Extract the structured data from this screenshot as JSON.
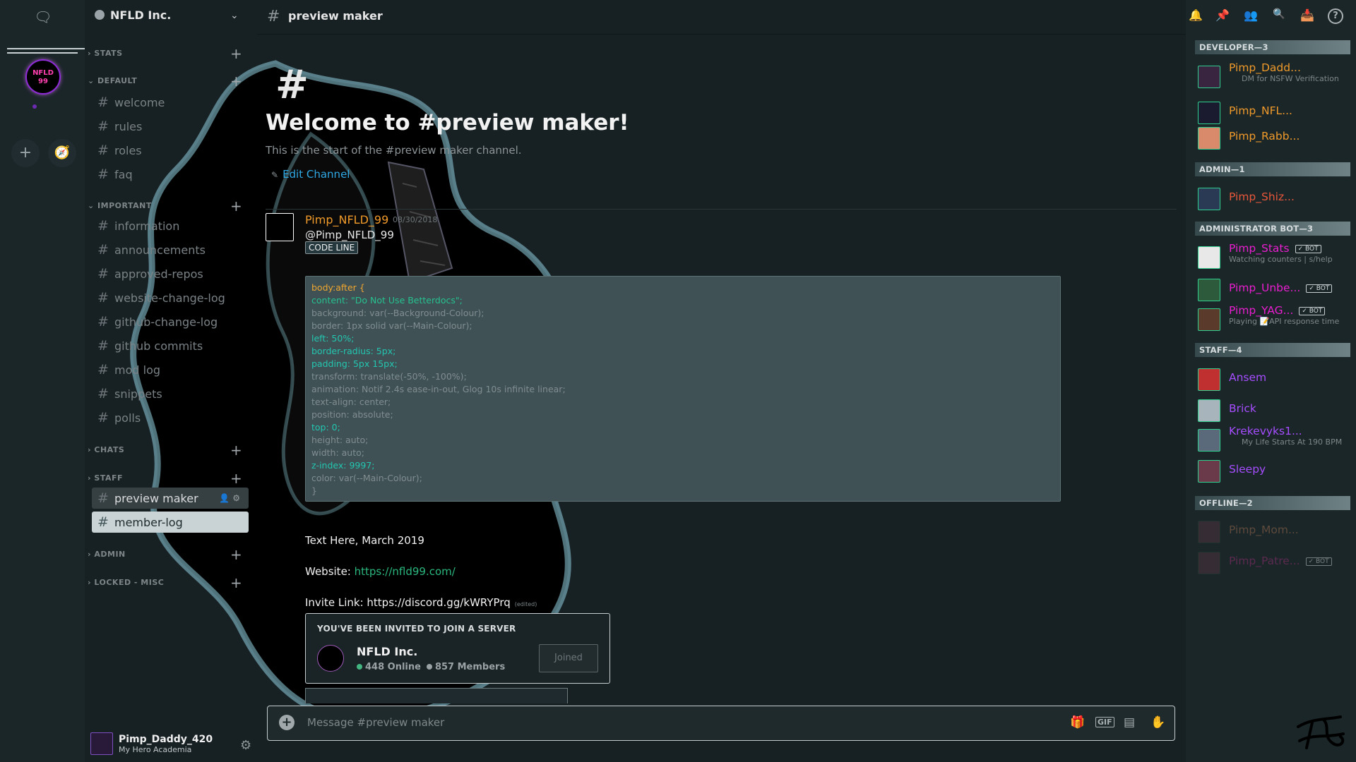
{
  "server": {
    "name": "NFLD Inc.",
    "icon_label": "NFLD 99"
  },
  "categories": [
    {
      "name": "STATS",
      "channels": []
    },
    {
      "name": "DEFAULT",
      "channels": [
        "welcome",
        "rules",
        "roles",
        "faq"
      ]
    },
    {
      "name": "IMPORTANT",
      "channels": [
        "information",
        "announcements",
        "approved-repos",
        "website-change-log",
        "github-change-log",
        "github commits",
        "mod log",
        "snippets",
        "polls"
      ]
    },
    {
      "name": "CHATS",
      "channels": []
    },
    {
      "name": "STAFF",
      "channels": [
        "preview maker",
        "member-log"
      ]
    },
    {
      "name": "ADMIN",
      "channels": []
    },
    {
      "name": "LOCKED - MISC",
      "channels": []
    }
  ],
  "user": {
    "name": "Pimp_Daddy_420",
    "status": "My Hero Academia"
  },
  "header": {
    "channel_name": "preview maker"
  },
  "welcome": {
    "title": "Welcome to #preview maker!",
    "subtitle": "This is the start of the #preview maker channel.",
    "edit_label": "Edit Channel"
  },
  "message": {
    "author": "Pimp_NFLD_99",
    "timestamp": "08/30/2018",
    "mention": "@Pimp_NFLD_99",
    "code_button": "CODE LINE",
    "text_line": "Text Here, March 2019",
    "website_label": "Website:",
    "website_url": "https://nfld99.com/",
    "invite_label": "Invite Link:",
    "invite_url": "https://discord.gg/kWRYPrq",
    "edited": "(edited)"
  },
  "code_lines": [
    "body:after {",
    "content: \"Do Not Use Betterdocs\";",
    "background: var(--Background-Colour);",
    "border: 1px solid var(--Main-Colour);",
    "left: 50%;",
    "border-radius: 5px;",
    "padding: 5px 15px;",
    "transform: translate(-50%, -100%);",
    "animation: Notif 2.4s ease-in-out, Glog 10s infinite linear;",
    "text-align: center;",
    "position: absolute;",
    "top: 0;",
    "height: auto;",
    "width: auto;",
    "z-index: 9997;",
    "color: var(--Main-Colour);",
    "}"
  ],
  "invite": {
    "title": "YOU'VE BEEN INVITED TO JOIN A SERVER",
    "server_name": "NFLD Inc.",
    "online": "448 Online",
    "members": "857 Members",
    "button": "Joined"
  },
  "input": {
    "placeholder": "Message #preview maker"
  },
  "members": {
    "groups": [
      {
        "header": "DEVELOPER—3",
        "members": [
          {
            "name": "Pimp_Dadd...",
            "sub": "DM for NSFW Verification",
            "color": "#f09a2a"
          },
          {
            "name": "Pimp_NFL...",
            "sub": "",
            "color": "#f09a2a"
          },
          {
            "name": "Pimp_Rabb...",
            "sub": "",
            "color": "#f09a2a"
          }
        ]
      },
      {
        "header": "ADMIN—1",
        "members": [
          {
            "name": "Pimp_Shiz...",
            "sub": "",
            "color": "#e8573a"
          }
        ]
      },
      {
        "header": "ADMINISTRATOR BOT—3",
        "members": [
          {
            "name": "Pimp_Stats",
            "sub": "Watching counters | s/help",
            "color": "#e91ecf",
            "bot": "✓ BOT"
          },
          {
            "name": "Pimp_Unbe...",
            "sub": "",
            "color": "#e91ecf",
            "bot": "✓ BOT"
          },
          {
            "name": "Pimp_YAG...",
            "sub": "Playing 📝API response time",
            "color": "#e91ecf",
            "bot": "✓ BOT"
          }
        ]
      },
      {
        "header": "STAFF—4",
        "members": [
          {
            "name": "Ansem",
            "sub": "",
            "color": "#a64dff"
          },
          {
            "name": "Brick",
            "sub": "",
            "color": "#a64dff"
          },
          {
            "name": "Krekevyks1...",
            "sub": "My Life Starts At 190 BPM",
            "color": "#a64dff"
          },
          {
            "name": "Sleepy",
            "sub": "",
            "color": "#a64dff"
          }
        ]
      },
      {
        "header": "OFFLINE—2",
        "members": [
          {
            "name": "Pimp_Mom...",
            "sub": "",
            "color": "#5e4a3c"
          },
          {
            "name": "Pimp_Patre...",
            "sub": "",
            "color": "#5b2a4f",
            "bot": "✓ BOT"
          }
        ]
      }
    ]
  },
  "colors": {
    "accent_link": "#2fa8e6",
    "online": "#43b581",
    "author": "#f09a2a"
  }
}
